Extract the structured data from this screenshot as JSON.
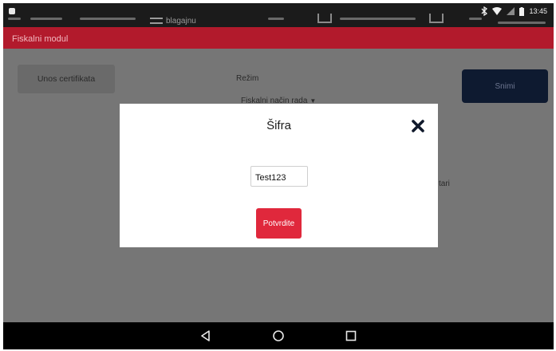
{
  "status_bar": {
    "time": "13:45",
    "blurred_text": "blagajnu",
    "icons": [
      "notification-icon",
      "bluetooth-icon",
      "wifi-icon",
      "signal-icon",
      "battery-icon"
    ]
  },
  "app_bar": {
    "title": "Fiskalni modul",
    "color": "#b21a2c"
  },
  "content": {
    "cert_button_label": "Unos certifikata",
    "mode_label": "Režim",
    "mode_value": "Fiskalni način rada",
    "save_button_label": "Snimi",
    "partial_text": "tari"
  },
  "dialog": {
    "title": "Šifra",
    "password_value": "Test123",
    "confirm_button_label": "Potvrdite",
    "close_icon": "close-icon",
    "accent_color": "#e0283c"
  },
  "nav_bar": {
    "icons": [
      "back-icon",
      "home-icon",
      "recents-icon"
    ]
  }
}
